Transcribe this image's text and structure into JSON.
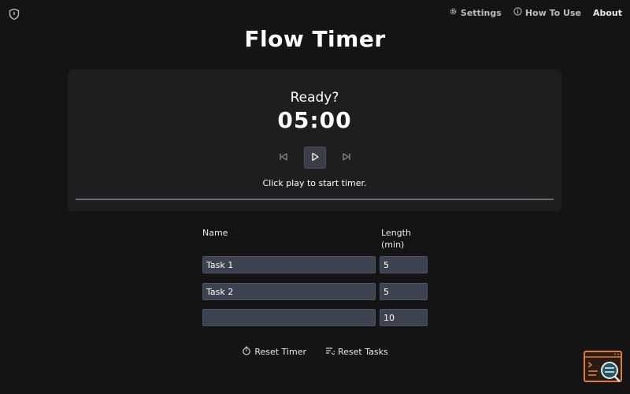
{
  "header": {
    "logo_icon": "shield-icon",
    "nav": [
      {
        "label": "Settings",
        "icon": "gear-icon"
      },
      {
        "label": "How To Use",
        "icon": "info-icon"
      },
      {
        "label": "About"
      }
    ]
  },
  "title": "Flow Timer",
  "timer": {
    "status": "Ready?",
    "time": "05:00",
    "hint": "Click play to start timer.",
    "progress": 0,
    "controls": [
      "skip-back-icon",
      "play-icon",
      "skip-forward-icon"
    ]
  },
  "tasks": {
    "name_header": "Name",
    "length_header_line1": "Length",
    "length_header_line2": "(min)",
    "rows": [
      {
        "name": "Task 1",
        "length": "5"
      },
      {
        "name": "Task 2",
        "length": "5"
      },
      {
        "name": "",
        "length": "10"
      }
    ]
  },
  "actions": {
    "reset_timer": "Reset Timer",
    "reset_tasks": "Reset Tasks"
  },
  "colors": {
    "background": "#141414",
    "card": "#1e1e1e",
    "input": "#3c4250",
    "widget_accent": "#e07b3f",
    "widget_teal": "#1f5a66"
  }
}
